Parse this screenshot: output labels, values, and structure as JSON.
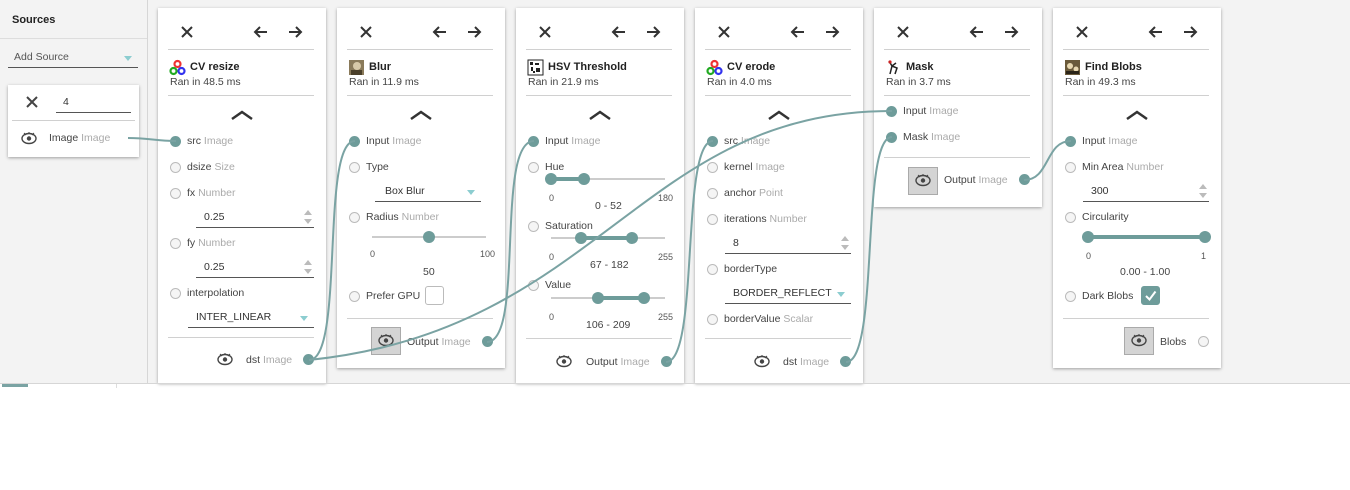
{
  "sources_panel": {
    "title": "Sources",
    "add_source": {
      "label": "Add Source"
    },
    "source_card": {
      "id_value": "4",
      "output_label": "Image",
      "output_type": "Image"
    }
  },
  "nodes": {
    "cv_resize": {
      "title": "CV resize",
      "status": "Ran in 48.5 ms",
      "inputs": {
        "src": {
          "label": "src",
          "type": "Image"
        },
        "dsize": {
          "label": "dsize",
          "type": "Size"
        },
        "fx": {
          "label": "fx",
          "type": "Number",
          "value": "0.25"
        },
        "fy": {
          "label": "fy",
          "type": "Number",
          "value": "0.25"
        },
        "interpolation": {
          "label": "interpolation",
          "value": "INTER_LINEAR"
        }
      },
      "output": {
        "label": "dst",
        "type": "Image"
      }
    },
    "blur": {
      "title": "Blur",
      "status": "Ran in 11.9 ms",
      "inputs": {
        "input": {
          "label": "Input",
          "type": "Image"
        },
        "type_param": {
          "label": "Type",
          "value": "Box Blur"
        },
        "radius": {
          "label": "Radius",
          "type": "Number",
          "min": "0",
          "max": "100",
          "value": "50"
        },
        "prefer_gpu": {
          "label": "Prefer GPU"
        }
      },
      "output": {
        "label": "Output",
        "type": "Image"
      }
    },
    "hsv": {
      "title": "HSV Threshold",
      "status": "Ran in 21.9 ms",
      "inputs": {
        "input": {
          "label": "Input",
          "type": "Image"
        },
        "hue": {
          "label": "Hue",
          "min": "0",
          "max": "180",
          "range": "0 - 52"
        },
        "saturation": {
          "label": "Saturation",
          "min": "0",
          "max": "255",
          "range": "67 - 182"
        },
        "value": {
          "label": "Value",
          "min": "0",
          "max": "255",
          "range": "106 - 209"
        }
      },
      "output": {
        "label": "Output",
        "type": "Image"
      }
    },
    "cv_erode": {
      "title": "CV erode",
      "status": "Ran in 4.0 ms",
      "inputs": {
        "src": {
          "label": "src",
          "type": "Image"
        },
        "kernel": {
          "label": "kernel",
          "type": "Image"
        },
        "anchor": {
          "label": "anchor",
          "type": "Point"
        },
        "iterations": {
          "label": "iterations",
          "type": "Number",
          "value": "8"
        },
        "border_type": {
          "label": "borderType",
          "value": "BORDER_REFLECT"
        },
        "border_value": {
          "label": "borderValue",
          "type": "Scalar"
        }
      },
      "output": {
        "label": "dst",
        "type": "Image"
      }
    },
    "mask": {
      "title": "Mask",
      "status": "Ran in 3.7 ms",
      "inputs": {
        "input": {
          "label": "Input",
          "type": "Image"
        },
        "mask": {
          "label": "Mask",
          "type": "Image"
        }
      },
      "output": {
        "label": "Output",
        "type": "Image"
      }
    },
    "find_blobs": {
      "title": "Find Blobs",
      "status": "Ran in 49.3 ms",
      "inputs": {
        "input": {
          "label": "Input",
          "type": "Image"
        },
        "min_area": {
          "label": "Min Area",
          "type": "Number",
          "value": "300"
        },
        "circularity": {
          "label": "Circularity",
          "min": "0",
          "max": "1",
          "range": "0.00 - 1.00"
        },
        "dark_blobs": {
          "label": "Dark Blobs",
          "checked": true
        }
      },
      "output": {
        "label": "Blobs"
      }
    }
  },
  "slider_values": {
    "blur_radius": {
      "min": 0,
      "max": 100,
      "value": 50
    },
    "hue": {
      "min": 0,
      "max": 180,
      "low": 0,
      "high": 52
    },
    "saturation": {
      "min": 0,
      "max": 255,
      "low": 67,
      "high": 182
    },
    "value": {
      "min": 0,
      "max": 255,
      "low": 106,
      "high": 209
    },
    "circularity": {
      "min": 0,
      "max": 1,
      "low": 0,
      "high": 1
    }
  },
  "colors": {
    "accent": "#6e9c9a",
    "caret": "#8ccdd0",
    "workspace": "#f3f3f3"
  },
  "icons": [
    "close-icon",
    "arrow-left-icon",
    "arrow-right-icon",
    "collapse-chevron-icon",
    "eye-icon",
    "opencv-icon",
    "blur-icon",
    "hsv-icon",
    "mask-icon",
    "blobs-icon",
    "checkmark-icon"
  ]
}
